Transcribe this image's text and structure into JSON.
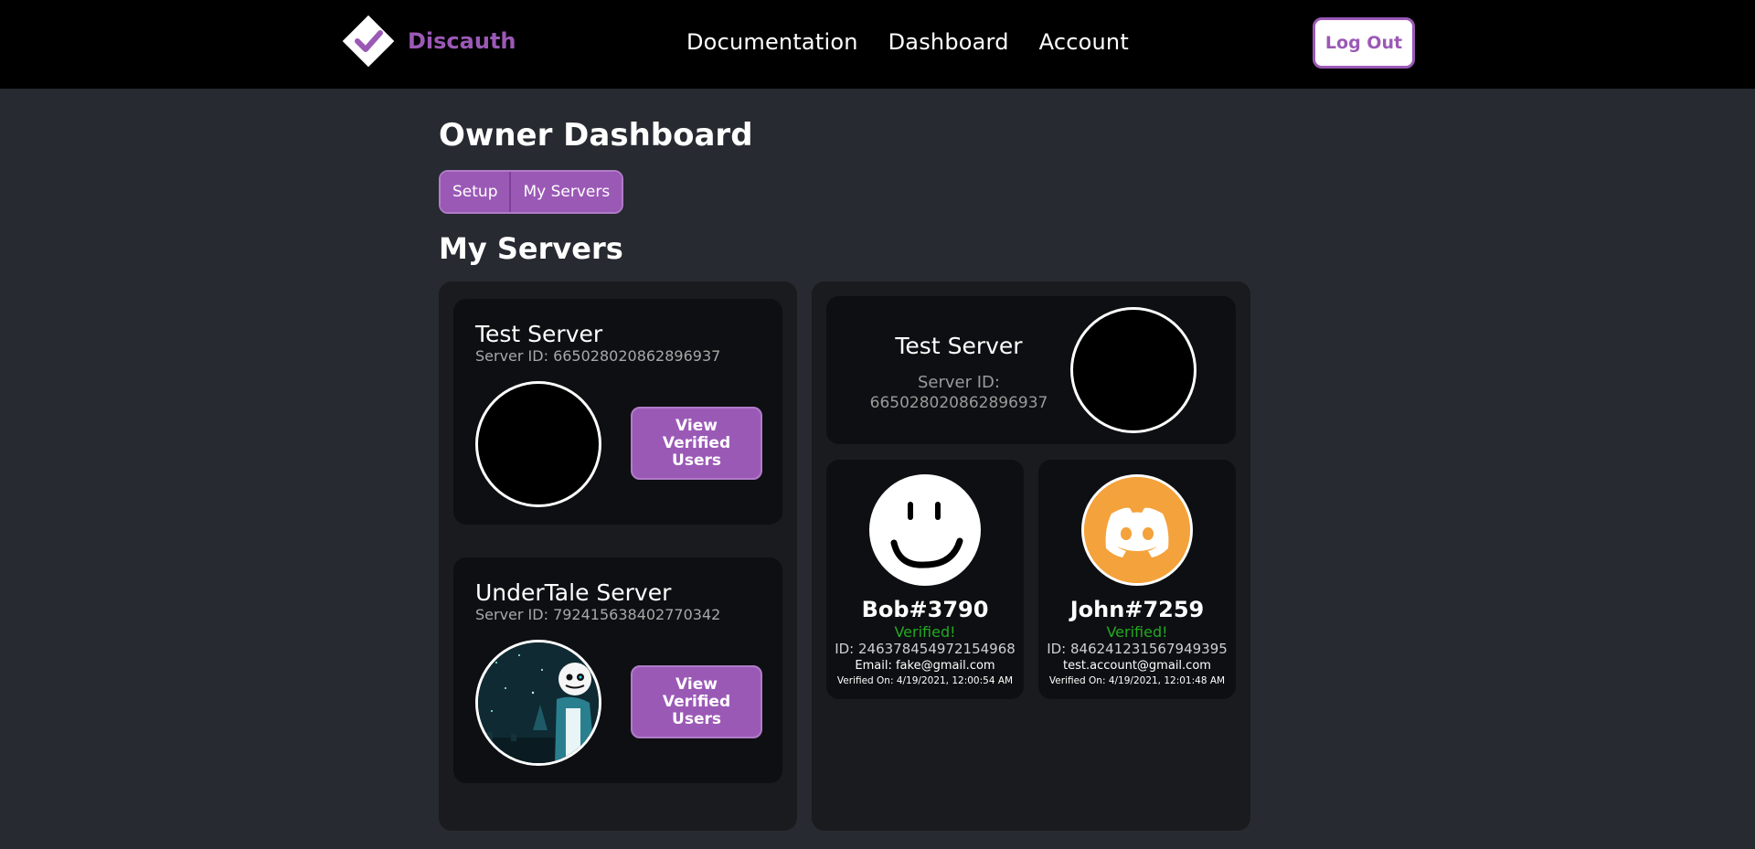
{
  "header": {
    "brand": "Discauth",
    "nav": [
      "Documentation",
      "Dashboard",
      "Account"
    ],
    "logout_label": "Log Out",
    "accent_color": "#9b59b6"
  },
  "page": {
    "title": "Owner Dashboard",
    "tabs": [
      "Setup",
      "My Servers"
    ],
    "section_title": "My Servers"
  },
  "servers": [
    {
      "name": "Test Server",
      "id_text": "Server ID: 665028020862896937",
      "avatar": "black-circle",
      "button_label": "View Verified Users"
    },
    {
      "name": "UnderTale Server",
      "id_text": "Server ID: 792415638402770342",
      "avatar": "undertale-sans-icon",
      "button_label": "View Verified Users"
    }
  ],
  "selected_server": {
    "name": "Test Server",
    "id_label": "Server ID:",
    "id_value": "665028020862896937"
  },
  "users": [
    {
      "name": "Bob#3790",
      "status": "Verified!",
      "id_text": "ID: 246378454972154968",
      "email_text": "Email: fake@gmail.com",
      "date_text": "Verified On: 4/19/2021, 12:00:54 AM",
      "avatar": "smiley-face-icon"
    },
    {
      "name": "John#7259",
      "status": "Verified!",
      "id_text": "ID: 846241231567949395",
      "email_text": "test.account@gmail.com",
      "date_text": "Verified On: 4/19/2021, 12:01:48 AM",
      "avatar": "discord-logo-icon",
      "avatar_color": "#f4a23b"
    }
  ]
}
